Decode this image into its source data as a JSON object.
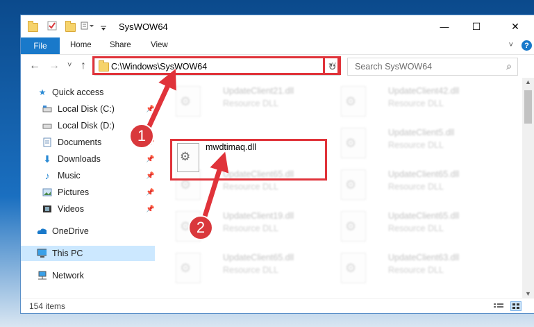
{
  "window": {
    "title": "SysWOW64",
    "minimize": "—",
    "maximize": "☐",
    "close": "✕"
  },
  "ribbon": {
    "file": "File",
    "tabs": [
      "Home",
      "Share",
      "View"
    ],
    "expand": "˅",
    "help": "?"
  },
  "address": {
    "path": "C:\\Windows\\SysWOW64",
    "dropdown": "˅",
    "refresh": "↻",
    "back": "←",
    "forward": "→",
    "recent": "˅",
    "up": "↑"
  },
  "search": {
    "placeholder": "Search SysWOW64",
    "icon": "⌕"
  },
  "nav": {
    "quick_access": "Quick access",
    "items": [
      {
        "label": "Local Disk (C:)",
        "pinned": true
      },
      {
        "label": "Local Disk (D:)",
        "pinned": false
      },
      {
        "label": "Documents",
        "pinned": true
      },
      {
        "label": "Downloads",
        "pinned": true
      },
      {
        "label": "Music",
        "pinned": true
      },
      {
        "label": "Pictures",
        "pinned": true
      },
      {
        "label": "Videos",
        "pinned": true
      }
    ],
    "onedrive": "OneDrive",
    "this_pc": "This PC",
    "network": "Network"
  },
  "files": {
    "highlighted": {
      "name": "mwdtimaq.dll"
    },
    "blurred": [
      {
        "name": "UpdateClient21.dll",
        "type": "Resource DLL"
      },
      {
        "name": "UpdateClient42.dll",
        "type": "Resource DLL"
      },
      {
        "name": "UpdateClient5.dll",
        "type": "Resource DLL"
      },
      {
        "name": "UpdateClient65.dll",
        "type": "Resource DLL"
      },
      {
        "name": "UpdateClient65.dll",
        "type": "Resource DLL"
      },
      {
        "name": "UpdateClient19.dll",
        "type": "Resource DLL"
      },
      {
        "name": "UpdateClient65.dll",
        "type": "Resource DLL"
      },
      {
        "name": "UpdateClient65.dll",
        "type": "Resource DLL"
      },
      {
        "name": "UpdateClient63.dll",
        "type": "Resource DLL"
      }
    ]
  },
  "status": {
    "count": "154 items"
  },
  "annotations": {
    "step1": "1",
    "step2": "2",
    "color": "#e0333a"
  }
}
